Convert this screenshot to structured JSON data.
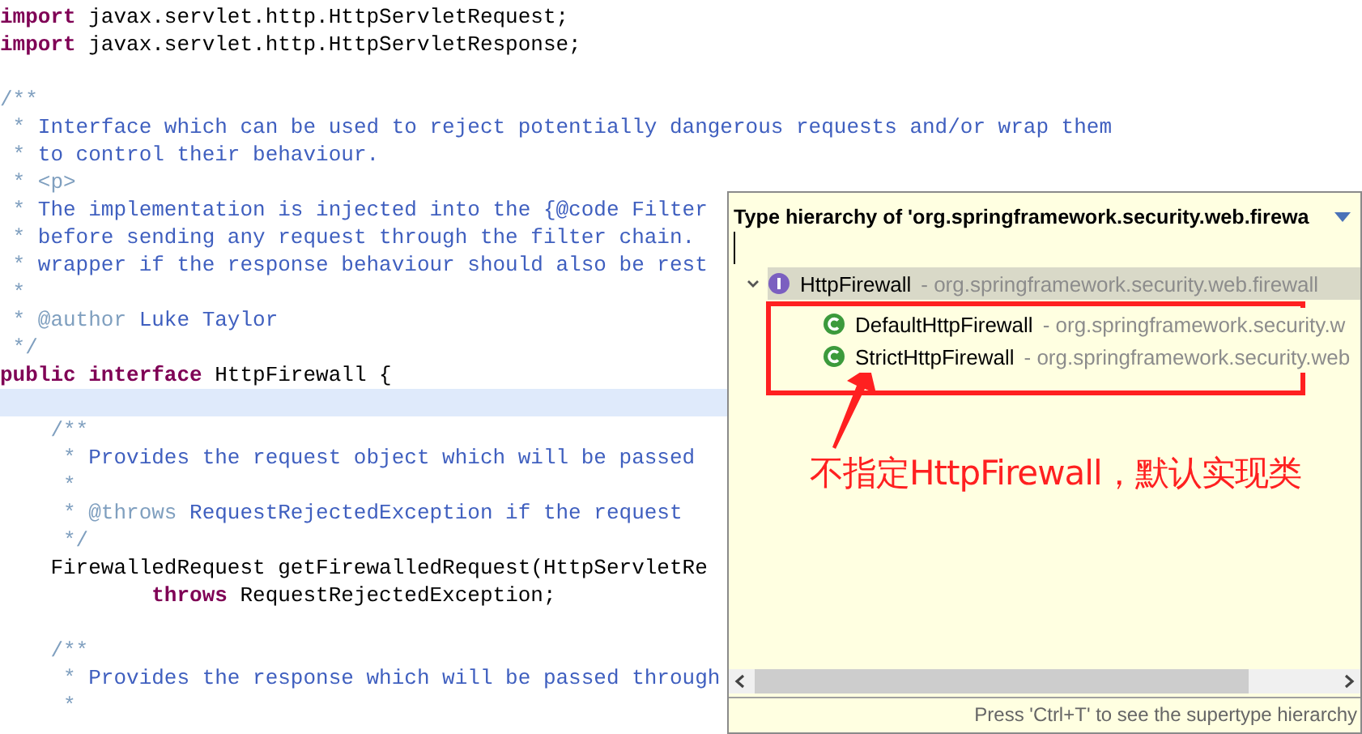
{
  "editor": {
    "lines": [
      {
        "kind": "code",
        "highlighted": false,
        "tokens": [
          {
            "kind": "keyword",
            "t": "import"
          },
          {
            "kind": "plain",
            "t": " javax.servlet.http.HttpServletRequest;"
          }
        ]
      },
      {
        "kind": "code",
        "highlighted": false,
        "tokens": [
          {
            "kind": "keyword",
            "t": "import"
          },
          {
            "kind": "plain",
            "t": " javax.servlet.http.HttpServletResponse;"
          }
        ]
      },
      {
        "kind": "blank"
      },
      {
        "kind": "code",
        "highlighted": false,
        "tokens": [
          {
            "kind": "marker",
            "t": "/**"
          }
        ]
      },
      {
        "kind": "code",
        "highlighted": false,
        "tokens": [
          {
            "kind": "marker",
            "t": " * "
          },
          {
            "kind": "javadoc",
            "t": "Interface which can be used to reject potentially dangerous requests and/or wrap them"
          }
        ]
      },
      {
        "kind": "code",
        "highlighted": false,
        "tokens": [
          {
            "kind": "marker",
            "t": " * "
          },
          {
            "kind": "javadoc",
            "t": "to control their behaviour."
          }
        ]
      },
      {
        "kind": "code",
        "highlighted": false,
        "tokens": [
          {
            "kind": "marker",
            "t": " * "
          },
          {
            "kind": "tag",
            "t": "<p>"
          }
        ]
      },
      {
        "kind": "code",
        "highlighted": false,
        "tokens": [
          {
            "kind": "marker",
            "t": " * "
          },
          {
            "kind": "javadoc",
            "t": "The implementation is injected into the {@code Filter"
          }
        ]
      },
      {
        "kind": "code",
        "highlighted": false,
        "tokens": [
          {
            "kind": "marker",
            "t": " * "
          },
          {
            "kind": "javadoc",
            "t": "before sending any request through the filter chain."
          }
        ]
      },
      {
        "kind": "code",
        "highlighted": false,
        "tokens": [
          {
            "kind": "marker",
            "t": " * "
          },
          {
            "kind": "javadoc",
            "t": "wrapper if the response behaviour should also be rest"
          }
        ]
      },
      {
        "kind": "code",
        "highlighted": false,
        "tokens": [
          {
            "kind": "marker",
            "t": " *"
          }
        ]
      },
      {
        "kind": "code",
        "highlighted": false,
        "tokens": [
          {
            "kind": "marker",
            "t": " * "
          },
          {
            "kind": "tag",
            "t": "@author"
          },
          {
            "kind": "javadoc",
            "t": " Luke Taylor"
          }
        ]
      },
      {
        "kind": "code",
        "highlighted": false,
        "tokens": [
          {
            "kind": "marker",
            "t": " */"
          }
        ]
      },
      {
        "kind": "code",
        "highlighted": false,
        "tokens": [
          {
            "kind": "keyword",
            "t": "public interface"
          },
          {
            "kind": "plain",
            "t": " HttpFirewall {"
          }
        ]
      },
      {
        "kind": "blank",
        "highlighted": true
      },
      {
        "kind": "code",
        "highlighted": false,
        "tokens": [
          {
            "kind": "marker",
            "t": "    /**"
          }
        ]
      },
      {
        "kind": "code",
        "highlighted": false,
        "tokens": [
          {
            "kind": "marker",
            "t": "     * "
          },
          {
            "kind": "javadoc",
            "t": "Provides the request object which will be passed"
          }
        ]
      },
      {
        "kind": "code",
        "highlighted": false,
        "tokens": [
          {
            "kind": "marker",
            "t": "     *"
          }
        ]
      },
      {
        "kind": "code",
        "highlighted": false,
        "tokens": [
          {
            "kind": "marker",
            "t": "     * "
          },
          {
            "kind": "tag",
            "t": "@throws"
          },
          {
            "kind": "javadoc",
            "t": " RequestRejectedException if the request"
          }
        ]
      },
      {
        "kind": "code",
        "highlighted": false,
        "tokens": [
          {
            "kind": "marker",
            "t": "     */"
          }
        ]
      },
      {
        "kind": "code",
        "highlighted": false,
        "tokens": [
          {
            "kind": "plain",
            "t": "    FirewalledRequest getFirewalledRequest(HttpServletRe"
          }
        ]
      },
      {
        "kind": "code",
        "highlighted": false,
        "tokens": [
          {
            "kind": "keyword",
            "t": "            throws"
          },
          {
            "kind": "plain",
            "t": " RequestRejectedException;"
          }
        ]
      },
      {
        "kind": "blank"
      },
      {
        "kind": "code",
        "highlighted": false,
        "tokens": [
          {
            "kind": "marker",
            "t": "    /**"
          }
        ]
      },
      {
        "kind": "code",
        "highlighted": false,
        "tokens": [
          {
            "kind": "marker",
            "t": "     * "
          },
          {
            "kind": "javadoc",
            "t": "Provides the response which will be passed through"
          }
        ]
      },
      {
        "kind": "code",
        "highlighted": false,
        "tokens": [
          {
            "kind": "marker",
            "t": "     *"
          }
        ]
      }
    ]
  },
  "hierarchy_popup": {
    "title": "Type hierarchy of 'org.springframework.security.web.firewa",
    "tree": [
      {
        "kind": "interface",
        "name": "HttpFirewall",
        "package": " - org.springframework.security.web.firewall",
        "selected": true,
        "expanded": true,
        "children": [
          {
            "kind": "class",
            "name": "DefaultHttpFirewall",
            "package": " - org.springframework.security.w",
            "selected": false
          },
          {
            "kind": "class",
            "name": "StrictHttpFirewall",
            "package": " - org.springframework.security.web",
            "selected": false
          }
        ]
      }
    ],
    "hint": "Press 'Ctrl+T' to see the supertype hierarchy"
  },
  "annotation": {
    "text": "不指定HttpFirewall，默认实现类",
    "color": "#ff2020"
  }
}
